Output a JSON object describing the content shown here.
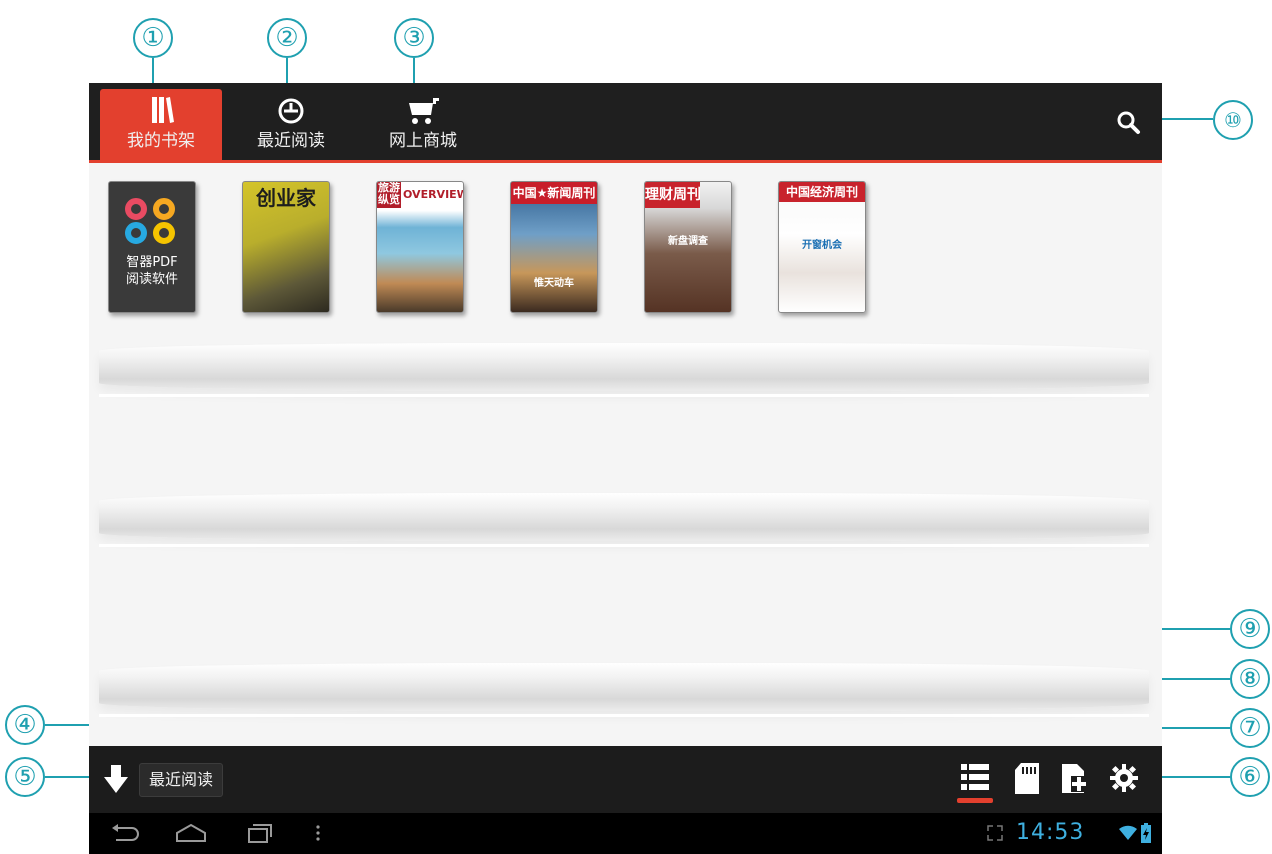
{
  "tabs": [
    {
      "label": "我的书架",
      "icon": "bookshelf-icon",
      "active": true
    },
    {
      "label": "最近阅读",
      "icon": "recent-reading-icon",
      "active": false
    },
    {
      "label": "网上商城",
      "icon": "shopping-cart-icon",
      "active": false
    }
  ],
  "search": {
    "icon": "search-icon"
  },
  "shelf": {
    "books": [
      {
        "type": "app",
        "title": "智器PDF\n阅读软件",
        "name": "智器PDF阅读软件"
      },
      {
        "type": "magazine",
        "mast": "创业家"
      },
      {
        "type": "magazine",
        "mast": "旅游纵览",
        "subtitle": "OVERVIEW"
      },
      {
        "type": "magazine",
        "mast": "中国★新闻周刊",
        "cover_line": "惟天动车"
      },
      {
        "type": "magazine",
        "mast": "理财周刊",
        "cover_line": "新盘调查"
      },
      {
        "type": "magazine",
        "mast": "中国经济周刊",
        "cover_line": "开窗机会"
      }
    ]
  },
  "actionbar": {
    "down_icon": "download-arrow-icon",
    "recent_label": "最近阅读",
    "actions": [
      "list-view-icon",
      "sd-card-icon",
      "add-file-icon",
      "gear-icon"
    ]
  },
  "system": {
    "time": "14:53",
    "nav": [
      "back-icon",
      "home-icon",
      "recent-apps-icon",
      "menu-dots-icon"
    ]
  },
  "callouts": [
    "①",
    "②",
    "③",
    "④",
    "⑤",
    "⑥",
    "⑦",
    "⑧",
    "⑨",
    "⑩"
  ],
  "colors": {
    "accent": "#e3402e",
    "annotation": "#1fa0b0",
    "clock": "#3fb0e0"
  }
}
